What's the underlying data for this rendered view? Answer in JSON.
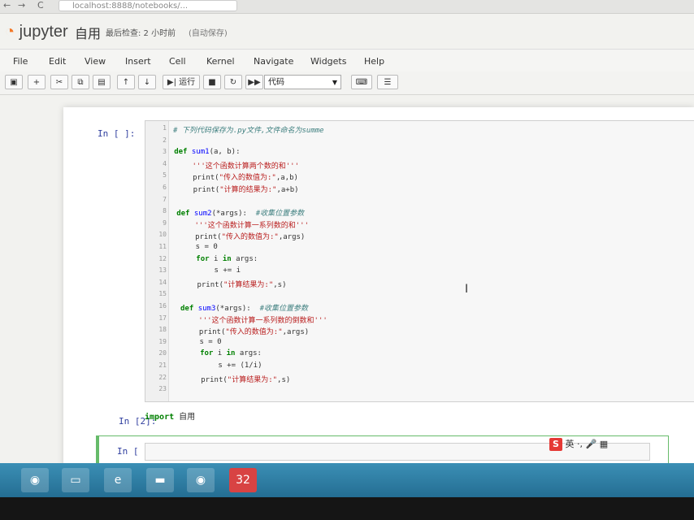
{
  "browser": {
    "back_icon": "←",
    "forward_icon": "→",
    "reload_icon": "C",
    "url": "localhost:8888/notebooks/..."
  },
  "header": {
    "logo_text": "jupyter",
    "notebook_name": "自用",
    "checkpoint": "最后检查: 2 小时前",
    "autosave": "(自动保存)"
  },
  "menu": [
    "File",
    "Edit",
    "View",
    "Insert",
    "Cell",
    "Kernel",
    "Navigate",
    "Widgets",
    "Help"
  ],
  "toolbar": {
    "run_label": "运行",
    "cell_type": "代码"
  },
  "cells": {
    "cell1_prompt": "In [ ]:",
    "cell2_prompt": "In [2]:",
    "cell3_prompt": "In [ ]:",
    "cell2_code_kw": "import",
    "cell2_code_name": "自用"
  },
  "code_lines": [
    "# 下列代码保存为.py文件,文件命名为summe",
    "",
    "def sum1(a, b):",
    "    '''这个函数计算两个数的和'''",
    "    print(\"传入的数值为:\",a,b)",
    "    print(\"计算的结果为:\",a+b)",
    "",
    "def sum2(*args):  #收集位置参数",
    "    '''这个函数计算一系列数的和'''",
    "    print(\"传入的数值为:\",args)",
    "    s = 0",
    "    for i in args:",
    "        s += i",
    "    print(\"计算结果为:\",s)",
    "",
    "def sum3(*args):  #收集位置参数",
    "    '''这个函数计算一系列数的倒数和'''",
    "    print(\"传入的数值为:\",args)",
    "    s = 0",
    "    for i in args:",
    "        s += (1/i)",
    "    print(\"计算结果为:\",s)",
    ""
  ],
  "ime": {
    "logo": "S",
    "mode": "英"
  },
  "taskbar": {
    "chrome_label": "◉",
    "badge_label": "32"
  }
}
